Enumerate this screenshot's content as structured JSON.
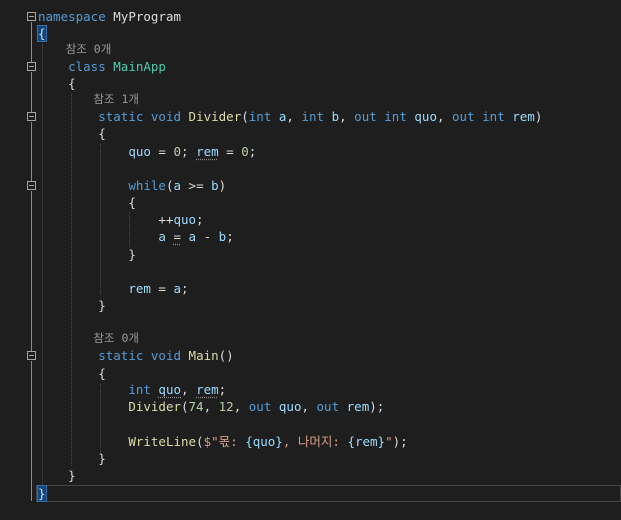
{
  "code": {
    "namespace_kw": "namespace",
    "namespace_name": "MyProgram",
    "open_brace": "{",
    "close_brace": "}",
    "ref_0": "참조 0개",
    "ref_1": "참조 1개",
    "class_kw": "class",
    "class_name": "MainApp",
    "static_kw": "static",
    "void_kw": "void",
    "int_kw": "int",
    "out_kw": "out",
    "while_kw": "while",
    "divider_name": "Divider",
    "main_name": "Main",
    "writeline_name": "WriteLine",
    "param_a": "a",
    "param_b": "b",
    "param_quo": "quo",
    "param_rem": "rem",
    "num_zero": "0",
    "num_74": "74",
    "num_12": "12",
    "str_dollar_quote": "$\"",
    "str_mok": "몫: ",
    "str_comma_remainder": ", 나머지: ",
    "str_close": "\"",
    "interp_quo": "{quo}",
    "interp_rem": "{rem}"
  },
  "colors": {
    "background": "#1e1e1e",
    "keyword": "#569cd6",
    "type": "#4ec9b0",
    "method": "#dcdcaa",
    "variable": "#9cdcfe",
    "number": "#b5cea8",
    "string": "#d69d85"
  }
}
